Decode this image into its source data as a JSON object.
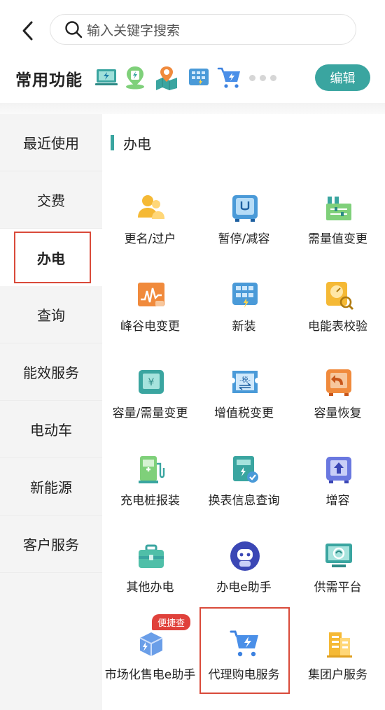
{
  "search": {
    "placeholder": "输入关键字搜索"
  },
  "common": {
    "title": "常用功能",
    "icons": [
      "screen-bolt-icon",
      "charger-pin-icon",
      "map-pin-icon",
      "meter-grid-icon",
      "cart-bolt-icon"
    ],
    "edit_label": "编辑"
  },
  "sidebar": {
    "items": [
      {
        "label": "最近使用"
      },
      {
        "label": "交费"
      },
      {
        "label": "办电",
        "active": true
      },
      {
        "label": "查询"
      },
      {
        "label": "能效服务"
      },
      {
        "label": "电动车"
      },
      {
        "label": "新能源"
      },
      {
        "label": "客户服务"
      }
    ]
  },
  "section": {
    "title": "办电",
    "tiles": [
      {
        "label": "更名/过户",
        "icon": "users-icon"
      },
      {
        "label": "暂停/减容",
        "icon": "pause-meter-icon"
      },
      {
        "label": "需量值变更",
        "icon": "factory-icon"
      },
      {
        "label": "峰谷电变更",
        "icon": "wave-chart-icon"
      },
      {
        "label": "新装",
        "icon": "meter-grid-icon"
      },
      {
        "label": "电能表校验",
        "icon": "gauge-search-icon"
      },
      {
        "label": "容量/需量变更",
        "icon": "yen-box-icon"
      },
      {
        "label": "增值税变更",
        "icon": "tax-ticket-icon"
      },
      {
        "label": "容量恢复",
        "icon": "restore-arrow-icon"
      },
      {
        "label": "充电桩报装",
        "icon": "charging-pile-icon"
      },
      {
        "label": "换表信息查询",
        "icon": "meter-check-icon"
      },
      {
        "label": "增容",
        "icon": "up-arrow-box-icon"
      },
      {
        "label": "其他办电",
        "icon": "briefcase-icon"
      },
      {
        "label": "办电e助手",
        "icon": "robot-icon"
      },
      {
        "label": "供需平台",
        "icon": "monitor-leaf-icon"
      },
      {
        "label": "市场化售电e助手",
        "icon": "cube-bolt-icon",
        "badge": "便捷查"
      },
      {
        "label": "代理购电服务",
        "icon": "cart-bolt-icon"
      },
      {
        "label": "集团户服务",
        "icon": "buildings-icon"
      }
    ]
  }
}
